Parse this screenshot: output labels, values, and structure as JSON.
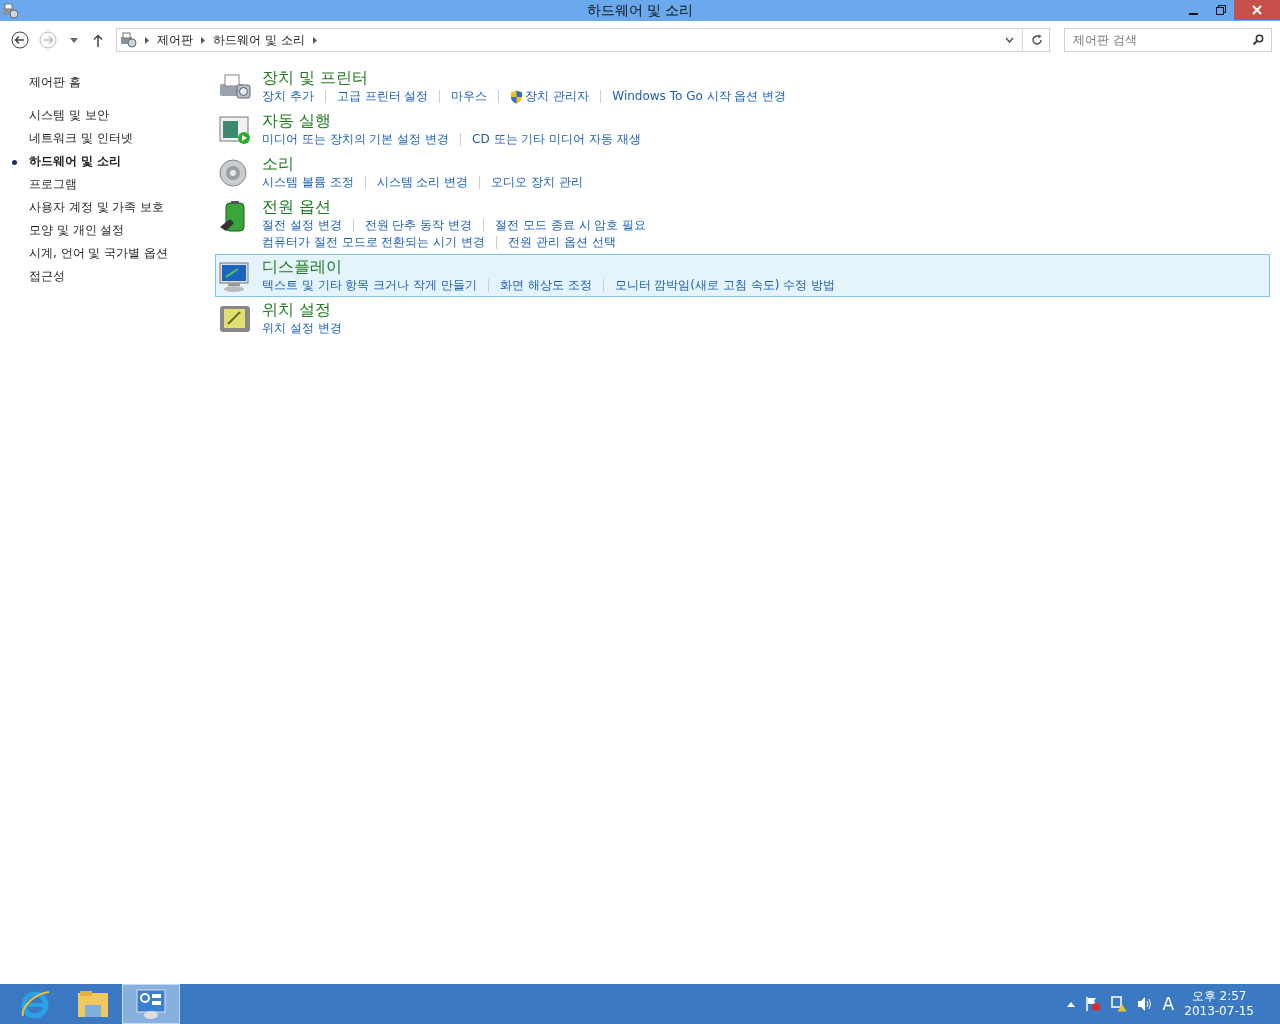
{
  "window": {
    "title": "하드웨어 및 소리"
  },
  "address_bar": {
    "breadcrumb": [
      "제어판",
      "하드웨어 및 소리"
    ]
  },
  "search": {
    "placeholder": "제어판 검색"
  },
  "sidebar": {
    "home": "제어판 홈",
    "items": [
      {
        "label": "시스템 및 보안",
        "selected": false
      },
      {
        "label": "네트워크 및 인터넷",
        "selected": false
      },
      {
        "label": "하드웨어 및 소리",
        "selected": true
      },
      {
        "label": "프로그램",
        "selected": false
      },
      {
        "label": "사용자 계정 및 가족 보호",
        "selected": false
      },
      {
        "label": "모양 및 개인 설정",
        "selected": false
      },
      {
        "label": "시계, 언어 및 국가별 옵션",
        "selected": false
      },
      {
        "label": "접근성",
        "selected": false
      }
    ]
  },
  "categories": [
    {
      "title": "장치 및 프린터",
      "kind": "printer",
      "selected": false,
      "lines": [
        [
          {
            "label": "장치 추가",
            "kind": "plain"
          },
          {
            "label": "고급 프린터 설정",
            "kind": "plain"
          },
          {
            "label": "마우스",
            "kind": "plain"
          },
          {
            "label": "장치 관리자",
            "kind": "shield"
          },
          {
            "label": "Windows To Go 시작 옵션 변경",
            "kind": "plain"
          }
        ]
      ]
    },
    {
      "title": "자동 실행",
      "kind": "autoplay",
      "selected": false,
      "lines": [
        [
          {
            "label": "미디어 또는 장치의 기본 설정 변경",
            "kind": "plain"
          },
          {
            "label": "CD 또는 기타 미디어 자동 재생",
            "kind": "plain"
          }
        ]
      ]
    },
    {
      "title": "소리",
      "kind": "speaker",
      "selected": false,
      "lines": [
        [
          {
            "label": "시스템 볼륨 조정",
            "kind": "plain"
          },
          {
            "label": "시스템 소리 변경",
            "kind": "plain"
          },
          {
            "label": "오디오 장치 관리",
            "kind": "plain"
          }
        ]
      ]
    },
    {
      "title": "전원 옵션",
      "kind": "battery",
      "selected": false,
      "lines": [
        [
          {
            "label": "절전 설정 변경",
            "kind": "plain"
          },
          {
            "label": "전원 단추 동작 변경",
            "kind": "plain"
          },
          {
            "label": "절전 모드 종료 시 암호 필요",
            "kind": "plain"
          }
        ],
        [
          {
            "label": "컴퓨터가 절전 모드로 전환되는 시기 변경",
            "kind": "plain"
          },
          {
            "label": "전원 관리 옵션 선택",
            "kind": "plain"
          }
        ]
      ]
    },
    {
      "title": "디스플레이",
      "kind": "monitor",
      "selected": true,
      "lines": [
        [
          {
            "label": "텍스트 및 기타 항목 크거나 작게 만들기",
            "kind": "plain"
          },
          {
            "label": "화면 해상도 조정",
            "kind": "plain"
          },
          {
            "label": "모니터 깜박임(새로 고침 속도) 수정 방법",
            "kind": "plain"
          }
        ]
      ]
    },
    {
      "title": "위치 설정",
      "kind": "location",
      "selected": false,
      "lines": [
        [
          {
            "label": "위치 설정 변경",
            "kind": "plain"
          }
        ]
      ]
    }
  ],
  "taskbar": {
    "apps": [
      {
        "kind": "browser",
        "selected": false
      },
      {
        "kind": "folder",
        "selected": false
      },
      {
        "kind": "control-panel",
        "selected": true
      }
    ],
    "tray": {
      "ime": "A",
      "time": "오후 2:57",
      "date": "2013-07-15"
    }
  }
}
